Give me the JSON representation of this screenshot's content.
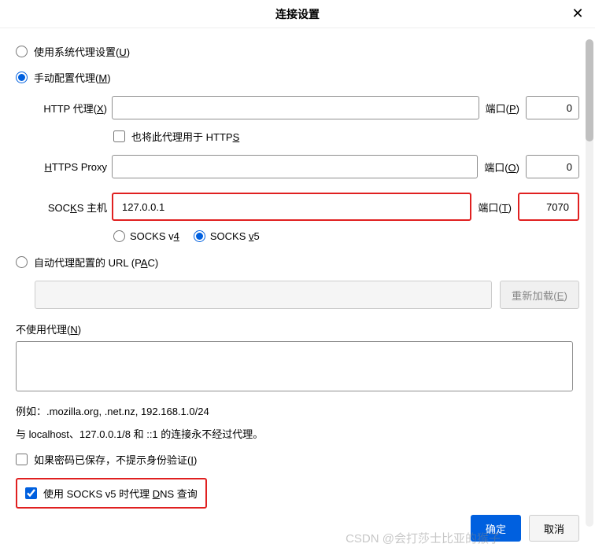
{
  "title": "连接设置",
  "radios": {
    "system": {
      "label_pre": "使用系统代理设置(",
      "label_u": "U",
      "label_post": ")",
      "checked": false
    },
    "manual": {
      "label_pre": "手动配置代理(",
      "label_u": "M",
      "label_post": ")",
      "checked": true
    },
    "pac": {
      "label_pre": "自动代理配置的 URL  (P",
      "label_u": "A",
      "label_post": "C)",
      "checked": false
    }
  },
  "http": {
    "label_pre": "HTTP 代理(",
    "label_u": "X",
    "label_post": ")",
    "value": "",
    "port_label_pre": "端口(",
    "port_label_u": "P",
    "port_label_post": ")",
    "port": "0"
  },
  "also_https": {
    "label_pre": "也将此代理用于 HTTP",
    "label_u": "S",
    "label_post": "",
    "checked": false
  },
  "https": {
    "label_pre": "",
    "label_u": "H",
    "label_post": "TTPS Proxy",
    "value": "",
    "port_label_pre": "端口(",
    "port_label_u": "O",
    "port_label_post": ")",
    "port": "0"
  },
  "socks": {
    "label_pre": "SOC",
    "label_u": "K",
    "label_post": "S 主机",
    "value": "127.0.0.1",
    "port_label_pre": "端口(",
    "port_label_u": "T",
    "port_label_post": ")",
    "port": "7070"
  },
  "socks_ver": {
    "v4_pre": "SOCKS v",
    "v4_u": "4",
    "v4_checked": false,
    "v5_pre": "SOCKS ",
    "v5_u": "v",
    "v5_post": "5",
    "v5_checked": true
  },
  "reload": {
    "label_pre": "重新加载(",
    "label_u": "E",
    "label_post": ")"
  },
  "noproxy": {
    "label_pre": "不使用代理(",
    "label_u": "N",
    "label_post": ")",
    "value": ""
  },
  "example": "例如：.mozilla.org, .net.nz, 192.168.1.0/24",
  "note": "与 localhost、127.0.0.1/8 和 ::1 的连接永不经过代理。",
  "no_prompt": {
    "label_pre": "如果密码已保存，不提示身份验证(",
    "label_u": "I",
    "label_post": ")",
    "checked": false
  },
  "dns": {
    "label_pre": "使用 SOCKS v5 时代理 ",
    "label_u": "D",
    "label_post": "NS 查询",
    "checked": true
  },
  "buttons": {
    "ok": "确定",
    "cancel": "取消"
  },
  "watermark": "CSDN @会打莎士比亚的猴子"
}
